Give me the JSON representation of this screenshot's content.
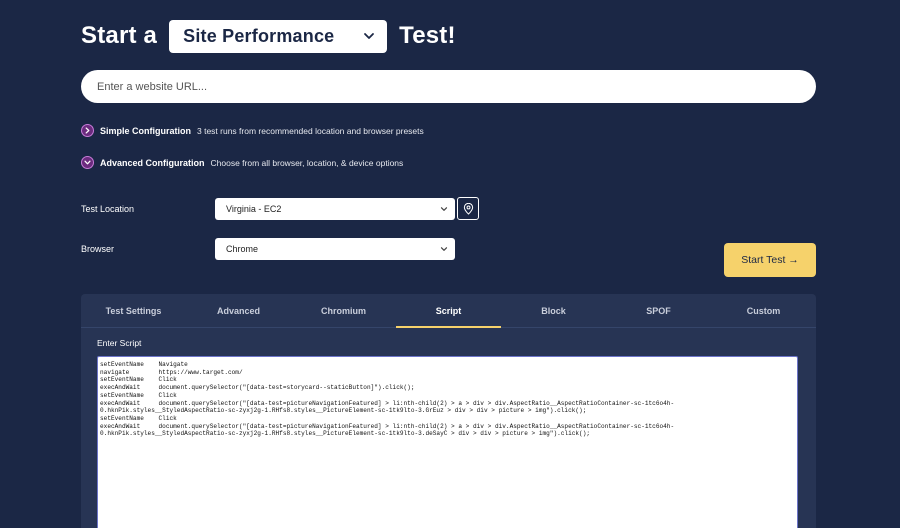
{
  "header": {
    "prefix": "Start a",
    "test_type_selected": "Site Performance",
    "suffix": "Test!"
  },
  "url_input": {
    "placeholder": "Enter a website URL...",
    "value": ""
  },
  "config": {
    "simple": {
      "title": "Simple Configuration",
      "description": "3 test runs from recommended location and browser presets"
    },
    "advanced": {
      "title": "Advanced Configuration",
      "description": "Choose from all browser, location, & device options"
    }
  },
  "form": {
    "location_label": "Test Location",
    "location_value": "Virginia - EC2",
    "browser_label": "Browser",
    "browser_value": "Chrome"
  },
  "start_button": "Start Test →",
  "tabs": [
    {
      "label": "Test Settings",
      "active": false
    },
    {
      "label": "Advanced",
      "active": false
    },
    {
      "label": "Chromium",
      "active": false
    },
    {
      "label": "Script",
      "active": true
    },
    {
      "label": "Block",
      "active": false
    },
    {
      "label": "SPOF",
      "active": false
    },
    {
      "label": "Custom",
      "active": false
    }
  ],
  "script": {
    "label": "Enter Script",
    "content": "setEventName    Navigate\nnavigate        https://www.target.com/\nsetEventName    Click\nexecAndWait     document.querySelector(\"[data-test=storycard--staticButton]\").click();\nsetEventName    Click\nexecAndWait     document.querySelector(\"[data-test=pictureNavigationFeatured] > li:nth-child(2) > a > div > div.AspectRatio__AspectRatioContainer-sc-1tc6o4h-0.hknPik.styles__StyledAspectRatio-sc-zyxj2g-1.RHfs8.styles__PictureElement-sc-1tk9lto-3.GrEuz > div > div > picture > img\").click();\nsetEventName    Click\nexecAndWait     document.querySelector(\"[data-test=pictureNavigationFeatured] > li:nth-child(2) > a > div > div.AspectRatio__AspectRatioContainer-sc-1tc6o4h-0.hknPik.styles__StyledAspectRatio-sc-zyxj2g-1.RHfs8.styles__PictureElement-sc-1tk9lto-3.deSayC > div > div > picture > img\").click();\n"
  },
  "colors": {
    "background": "#1b2745",
    "panel": "#273454",
    "accent": "#f6d26b",
    "config_circle": "#6b2b7e"
  },
  "icons": {
    "test_type_dropdown": "chevron-down-icon",
    "simple_config": "chevron-right-icon",
    "advanced_config": "chevron-down-icon",
    "location_dropdown": "chevron-down-icon",
    "location_pin": "map-pin-icon",
    "browser_dropdown": "chevron-down-icon"
  }
}
